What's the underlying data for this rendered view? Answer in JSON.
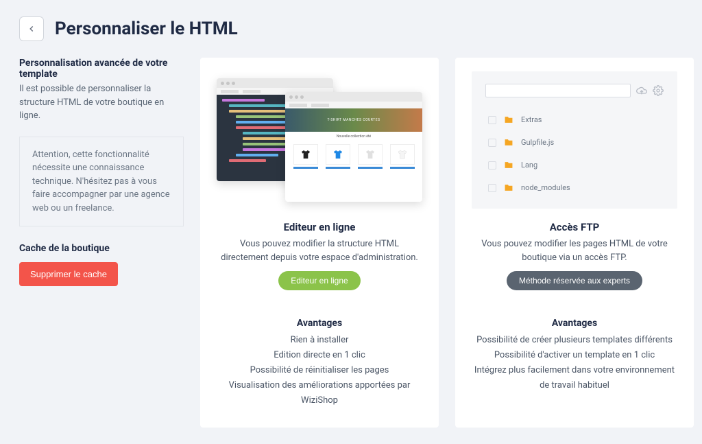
{
  "header": {
    "title": "Personnaliser le HTML"
  },
  "sidebar": {
    "intro": {
      "heading": "Personnalisation avancée de votre template",
      "text": "Il est possible de personnaliser la structure HTML de votre boutique en ligne."
    },
    "notice": "Attention, cette fonctionnalité nécessite une connaissance technique. N'hésitez pas à vous faire accompagner par une agence web ou un freelance.",
    "cache_section": {
      "heading": "Cache de la boutique",
      "button": "Supprimer le cache"
    }
  },
  "editor_card": {
    "title": "Editeur en ligne",
    "description": "Vous pouvez modifier la structure HTML directement depuis votre espace d'administration.",
    "cta": "Editeur en ligne",
    "shop_hero": "T-SHIRT MANCHES COURTES",
    "shop_banner": "Nouvelle collection été",
    "advantages_title": "Avantages",
    "advantages": [
      "Rien à installer",
      "Edition directe en 1 clic",
      "Possibilité de réinitialiser les pages",
      "Visualisation des améliorations apportées par WiziShop"
    ]
  },
  "ftp_card": {
    "title": "Accès FTP",
    "description": "Vous pouvez modifier les pages HTML de votre boutique via un accès FTP.",
    "cta": "Méthode réservée aux experts",
    "files": [
      "Extras",
      "Gulpfile.js",
      "Lang",
      "node_modules"
    ],
    "advantages_title": "Avantages",
    "advantages": [
      "Possibilité de créer plusieurs templates différents",
      "Possibilité d'activer un template en 1 clic",
      "Intégrez plus facilement dans votre environnement de travail habituel"
    ]
  }
}
